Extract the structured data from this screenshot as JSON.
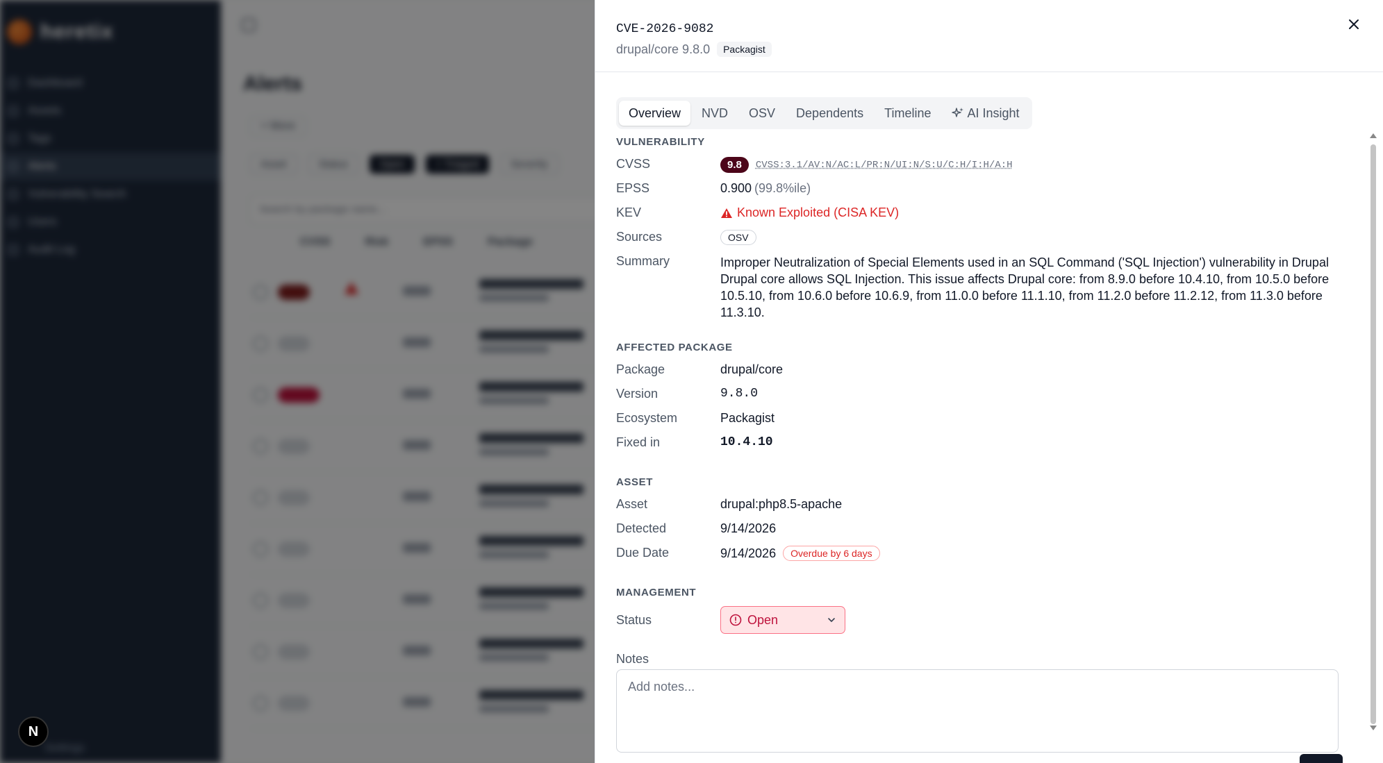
{
  "background": {
    "logo_text": "heretix",
    "nav": [
      {
        "label": "Dashboard"
      },
      {
        "label": "Assets"
      },
      {
        "label": "Tags"
      },
      {
        "label": "Alerts"
      },
      {
        "label": "Vulnerability Search"
      },
      {
        "label": "Users"
      },
      {
        "label": "Audit Log"
      }
    ],
    "settings_label": "Settings",
    "page_title": "Alerts",
    "more_label": "+ More",
    "filters": [
      "Asset",
      "Status",
      "Open",
      "+ Triaged",
      "Severity"
    ],
    "search_placeholder": "Search by package name...",
    "columns": [
      "CVSS",
      "Risk",
      "EPSS",
      "Package"
    ]
  },
  "next_badge": "N",
  "drawer": {
    "cve_id": "CVE-2026-9082",
    "package_version": "drupal/core 9.8.0",
    "ecosystem_badge": "Packagist",
    "close_icon": "close-icon",
    "tabs": [
      {
        "label": "Overview",
        "active": true
      },
      {
        "label": "NVD"
      },
      {
        "label": "OSV"
      },
      {
        "label": "Dependents"
      },
      {
        "label": "Timeline"
      },
      {
        "label": "AI Insight",
        "icon": "sparkles-icon"
      }
    ],
    "vulnerability": {
      "title": "VULNERABILITY",
      "cvss_label": "CVSS",
      "cvss_score": "9.8",
      "cvss_vector": "CVSS:3.1/AV:N/AC:L/PR:N/UI:N/S:U/C:H/I:H/A:H",
      "epss_label": "EPSS",
      "epss_value": "0.900",
      "epss_percentile": "(99.8%ile)",
      "kev_label": "KEV",
      "kev_value": "Known Exploited (CISA KEV)",
      "sources_label": "Sources",
      "sources_value": "OSV",
      "summary_label": "Summary",
      "summary_text": "Improper Neutralization of Special Elements used in an SQL Command ('SQL Injection') vulnerability in Drupal Drupal core allows SQL Injection. This issue affects Drupal core: from 8.9.0 before 10.4.10, from 10.5.0 before 10.5.10, from 10.6.0 before 10.6.9, from 11.0.0 before 11.1.10, from 11.2.0 before 11.2.12, from 11.3.0 before 11.3.10."
    },
    "affected_package": {
      "title": "AFFECTED PACKAGE",
      "package_label": "Package",
      "package_value": "drupal/core",
      "version_label": "Version",
      "version_value": "9.8.0",
      "ecosystem_label": "Ecosystem",
      "ecosystem_value": "Packagist",
      "fixed_label": "Fixed in",
      "fixed_value": "10.4.10"
    },
    "asset": {
      "title": "ASSET",
      "asset_label": "Asset",
      "asset_value": "drupal:php8.5-apache",
      "detected_label": "Detected",
      "detected_value": "9/14/2026",
      "due_label": "Due Date",
      "due_value": "9/14/2026",
      "overdue_badge": "Overdue by 6 days"
    },
    "management": {
      "title": "MANAGEMENT",
      "status_label": "Status",
      "status_value": "Open",
      "notes_label": "Notes",
      "notes_placeholder": "Add notes..."
    },
    "colors": {
      "cvss_badge": "#4c0519",
      "kev": "#dc2626",
      "fixed": "#15803d",
      "status_bg": "#ffe4e6"
    }
  }
}
